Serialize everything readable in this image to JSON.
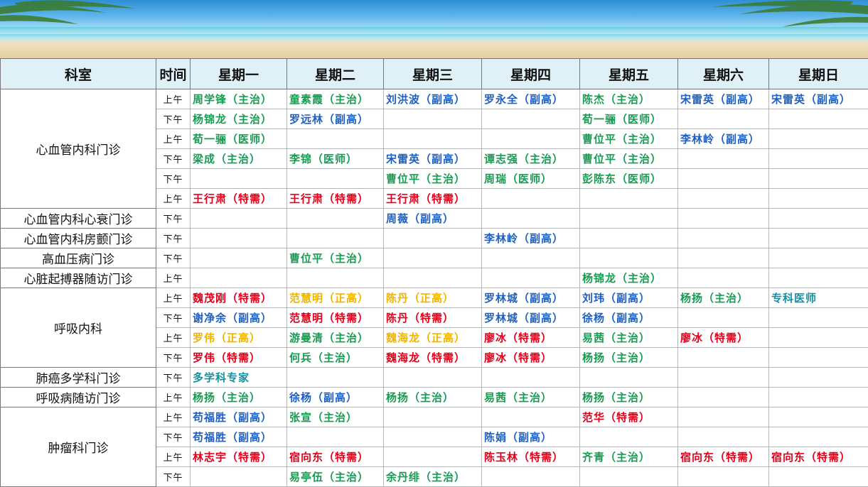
{
  "header": {
    "dept": "科室",
    "time": "时间",
    "days": [
      "星期一",
      "星期二",
      "星期三",
      "星期四",
      "星期五",
      "星期六",
      "星期日"
    ]
  },
  "groups": [
    {
      "dept": "心血管内科门诊",
      "rows": [
        {
          "time": "上午",
          "cells": [
            {
              "t": "周学锋（主治）",
              "c": "green"
            },
            {
              "t": "童素霞（主治）",
              "c": "green"
            },
            {
              "t": "刘洪波（副高）",
              "c": "blue"
            },
            {
              "t": "罗永全（副高）",
              "c": "blue"
            },
            {
              "t": "陈杰（主治）",
              "c": "green"
            },
            {
              "t": "宋雷英（副高）",
              "c": "blue"
            },
            {
              "t": "宋雷英（副高）",
              "c": "blue"
            }
          ]
        },
        {
          "time": "下午",
          "cells": [
            {
              "t": "杨锦龙（主治）",
              "c": "green"
            },
            {
              "t": "罗远林（副高）",
              "c": "blue"
            },
            {
              "t": "",
              "c": ""
            },
            {
              "t": "",
              "c": ""
            },
            {
              "t": "荀一骊（医师）",
              "c": "green"
            },
            {
              "t": "",
              "c": ""
            },
            {
              "t": "",
              "c": ""
            }
          ]
        },
        {
          "time": "上午",
          "cells": [
            {
              "t": "荀一骊（医师）",
              "c": "green"
            },
            {
              "t": "",
              "c": ""
            },
            {
              "t": "",
              "c": ""
            },
            {
              "t": "",
              "c": ""
            },
            {
              "t": "曹位平（主治）",
              "c": "green"
            },
            {
              "t": "李林岭（副高）",
              "c": "blue"
            },
            {
              "t": "",
              "c": ""
            }
          ]
        },
        {
          "time": "下午",
          "cells": [
            {
              "t": "梁成（主治）",
              "c": "green"
            },
            {
              "t": "李锦（医师）",
              "c": "green"
            },
            {
              "t": "宋雷英（副高）",
              "c": "blue"
            },
            {
              "t": "谭志强（主治）",
              "c": "green"
            },
            {
              "t": "曹位平（主治）",
              "c": "green"
            },
            {
              "t": "",
              "c": ""
            },
            {
              "t": "",
              "c": ""
            }
          ]
        },
        {
          "time": "下午",
          "cells": [
            {
              "t": "",
              "c": ""
            },
            {
              "t": "",
              "c": ""
            },
            {
              "t": "曹位平（主治）",
              "c": "green"
            },
            {
              "t": "周瑞（医师）",
              "c": "green"
            },
            {
              "t": "彭陈东（医师）",
              "c": "green"
            },
            {
              "t": "",
              "c": ""
            },
            {
              "t": "",
              "c": ""
            }
          ]
        },
        {
          "time": "上午",
          "cells": [
            {
              "t": "王行肃（特需）",
              "c": "red"
            },
            {
              "t": "王行肃（特需）",
              "c": "red"
            },
            {
              "t": "王行肃（特需）",
              "c": "red"
            },
            {
              "t": "",
              "c": ""
            },
            {
              "t": "",
              "c": ""
            },
            {
              "t": "",
              "c": ""
            },
            {
              "t": "",
              "c": ""
            }
          ]
        }
      ]
    },
    {
      "dept": "心血管内科心衰门诊",
      "rows": [
        {
          "time": "下午",
          "cells": [
            {
              "t": "",
              "c": ""
            },
            {
              "t": "",
              "c": ""
            },
            {
              "t": "周薇（副高）",
              "c": "blue"
            },
            {
              "t": "",
              "c": ""
            },
            {
              "t": "",
              "c": ""
            },
            {
              "t": "",
              "c": ""
            },
            {
              "t": "",
              "c": ""
            }
          ]
        }
      ]
    },
    {
      "dept": "心血管内科房颤门诊",
      "rows": [
        {
          "time": "下午",
          "cells": [
            {
              "t": "",
              "c": ""
            },
            {
              "t": "",
              "c": ""
            },
            {
              "t": "",
              "c": ""
            },
            {
              "t": "李林岭（副高）",
              "c": "blue"
            },
            {
              "t": "",
              "c": ""
            },
            {
              "t": "",
              "c": ""
            },
            {
              "t": "",
              "c": ""
            }
          ]
        }
      ]
    },
    {
      "dept": "高血压病门诊",
      "rows": [
        {
          "time": "下午",
          "cells": [
            {
              "t": "",
              "c": ""
            },
            {
              "t": "曹位平（主治）",
              "c": "green"
            },
            {
              "t": "",
              "c": ""
            },
            {
              "t": "",
              "c": ""
            },
            {
              "t": "",
              "c": ""
            },
            {
              "t": "",
              "c": ""
            },
            {
              "t": "",
              "c": ""
            }
          ]
        }
      ]
    },
    {
      "dept": "心脏起搏器随访门诊",
      "rows": [
        {
          "time": "上午",
          "cells": [
            {
              "t": "",
              "c": ""
            },
            {
              "t": "",
              "c": ""
            },
            {
              "t": "",
              "c": ""
            },
            {
              "t": "",
              "c": ""
            },
            {
              "t": "杨锦龙（主治）",
              "c": "green"
            },
            {
              "t": "",
              "c": ""
            },
            {
              "t": "",
              "c": ""
            }
          ]
        }
      ]
    },
    {
      "dept": "呼吸内科",
      "rows": [
        {
          "time": "上午",
          "cells": [
            {
              "t": "魏茂刚（特需）",
              "c": "red"
            },
            {
              "t": "范慧明（正高）",
              "c": "orange"
            },
            {
              "t": "陈丹（正高）",
              "c": "orange"
            },
            {
              "t": "罗林城（副高）",
              "c": "blue"
            },
            {
              "t": "刘玮（副高）",
              "c": "blue"
            },
            {
              "t": "杨扬（主治）",
              "c": "green"
            },
            {
              "t": "专科医师",
              "c": "teal"
            }
          ]
        },
        {
          "time": "下午",
          "cells": [
            {
              "t": "谢净余（副高）",
              "c": "blue"
            },
            {
              "t": "范慧明（特需）",
              "c": "red"
            },
            {
              "t": "陈丹（特需）",
              "c": "red"
            },
            {
              "t": "罗林城（副高）",
              "c": "blue"
            },
            {
              "t": "徐杨（副高）",
              "c": "blue"
            },
            {
              "t": "",
              "c": ""
            },
            {
              "t": "",
              "c": ""
            }
          ]
        },
        {
          "time": "上午",
          "cells": [
            {
              "t": "罗伟（正高）",
              "c": "orange"
            },
            {
              "t": "游曼清（主治）",
              "c": "green"
            },
            {
              "t": "魏海龙（正高）",
              "c": "orange"
            },
            {
              "t": "廖冰（特需）",
              "c": "red"
            },
            {
              "t": "易茜（主治）",
              "c": "green"
            },
            {
              "t": "廖冰（特需）",
              "c": "red"
            },
            {
              "t": "",
              "c": ""
            }
          ]
        },
        {
          "time": "下午",
          "cells": [
            {
              "t": "罗伟（特需）",
              "c": "red"
            },
            {
              "t": "何兵（主治）",
              "c": "green"
            },
            {
              "t": "魏海龙（特需）",
              "c": "red"
            },
            {
              "t": "廖冰（特需）",
              "c": "red"
            },
            {
              "t": "杨扬（主治）",
              "c": "green"
            },
            {
              "t": "",
              "c": ""
            },
            {
              "t": "",
              "c": ""
            }
          ]
        }
      ]
    },
    {
      "dept": "肺癌多学科门诊",
      "rows": [
        {
          "time": "下午",
          "cells": [
            {
              "t": "多学科专家",
              "c": "teal"
            },
            {
              "t": "",
              "c": ""
            },
            {
              "t": "",
              "c": ""
            },
            {
              "t": "",
              "c": ""
            },
            {
              "t": "",
              "c": ""
            },
            {
              "t": "",
              "c": ""
            },
            {
              "t": "",
              "c": ""
            }
          ]
        }
      ]
    },
    {
      "dept": "呼吸病随访门诊",
      "rows": [
        {
          "time": "上午",
          "cells": [
            {
              "t": "杨扬（主治）",
              "c": "green"
            },
            {
              "t": "徐杨（副高）",
              "c": "blue"
            },
            {
              "t": "杨扬（主治）",
              "c": "green"
            },
            {
              "t": "易茜（主治）",
              "c": "green"
            },
            {
              "t": "杨扬（主治）",
              "c": "green"
            },
            {
              "t": "",
              "c": ""
            },
            {
              "t": "",
              "c": ""
            }
          ]
        }
      ]
    },
    {
      "dept": "肿瘤科门诊",
      "rows": [
        {
          "time": "上午",
          "cells": [
            {
              "t": "苟福胜（副高）",
              "c": "blue"
            },
            {
              "t": "张宣（主治）",
              "c": "green"
            },
            {
              "t": "",
              "c": ""
            },
            {
              "t": "",
              "c": ""
            },
            {
              "t": "范华（特需）",
              "c": "red"
            },
            {
              "t": "",
              "c": ""
            },
            {
              "t": "",
              "c": ""
            }
          ]
        },
        {
          "time": "下午",
          "cells": [
            {
              "t": "苟福胜（副高）",
              "c": "blue"
            },
            {
              "t": "",
              "c": ""
            },
            {
              "t": "",
              "c": ""
            },
            {
              "t": "陈娟（副高）",
              "c": "blue"
            },
            {
              "t": "",
              "c": ""
            },
            {
              "t": "",
              "c": ""
            },
            {
              "t": "",
              "c": ""
            }
          ]
        },
        {
          "time": "上午",
          "cells": [
            {
              "t": "林志宇（特需）",
              "c": "red"
            },
            {
              "t": "宿向东（特需）",
              "c": "red"
            },
            {
              "t": "",
              "c": ""
            },
            {
              "t": "陈玉林（特需）",
              "c": "red"
            },
            {
              "t": "齐青（主治）",
              "c": "green"
            },
            {
              "t": "宿向东（特需）",
              "c": "red"
            },
            {
              "t": "宿向东（特需）",
              "c": "red"
            }
          ]
        },
        {
          "time": "下午",
          "cells": [
            {
              "t": "",
              "c": ""
            },
            {
              "t": "易亭伍（主治）",
              "c": "green"
            },
            {
              "t": "余丹绯（主治）",
              "c": "green"
            },
            {
              "t": "",
              "c": ""
            },
            {
              "t": "",
              "c": ""
            },
            {
              "t": "",
              "c": ""
            },
            {
              "t": "",
              "c": ""
            }
          ]
        }
      ]
    }
  ]
}
